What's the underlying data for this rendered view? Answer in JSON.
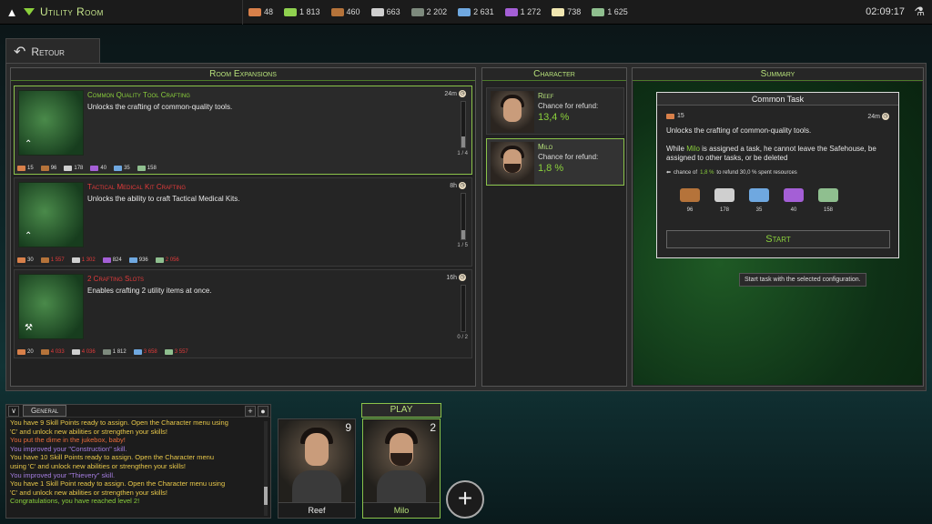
{
  "topbar": {
    "title": "Utility Room",
    "clock": "02:09:17",
    "resources": [
      {
        "icon": "strength-icon",
        "value": "48",
        "color": "#d8804a"
      },
      {
        "icon": "cash-icon",
        "value": "1 813",
        "color": "#8fd14f"
      },
      {
        "icon": "wood-icon",
        "value": "460",
        "color": "#b5733a"
      },
      {
        "icon": "stone-icon",
        "value": "663",
        "color": "#cfcfcf"
      },
      {
        "icon": "metal-plate-icon",
        "value": "2 202",
        "color": "#7d8a7d"
      },
      {
        "icon": "pipe-icon",
        "value": "2 631",
        "color": "#6fa8e0"
      },
      {
        "icon": "fabric-icon",
        "value": "1 272",
        "color": "#a45fd6"
      },
      {
        "icon": "chemical-flask-icon",
        "value": "738",
        "color": "#f0e6b0"
      },
      {
        "icon": "banknotes-icon",
        "value": "1 625",
        "color": "#8fbf8f"
      }
    ]
  },
  "back_label": "Retour",
  "room_expansions": {
    "header": "Room Expansions",
    "items": [
      {
        "title": "Common Quality Tool Crafting",
        "title_color": "#8bd13c",
        "desc": "Unlocks the crafting of common-quality tools.",
        "time": "24m",
        "progress": "1 / 4",
        "fraction": 0.25,
        "costs": [
          {
            "v": "15",
            "c": "#d8804a",
            "red": false
          },
          {
            "v": "96",
            "c": "#b5733a",
            "red": false
          },
          {
            "v": "178",
            "c": "#cfcfcf",
            "red": false
          },
          {
            "v": "40",
            "c": "#a45fd6",
            "red": false
          },
          {
            "v": "35",
            "c": "#6fa8e0",
            "red": false
          },
          {
            "v": "158",
            "c": "#8fbf8f",
            "red": false
          }
        ]
      },
      {
        "title": "Tactical Medical Kit Crafting",
        "title_color": "#e23b3b",
        "desc": "Unlocks the ability to craft Tactical Medical Kits.",
        "time": "8h",
        "progress": "1 / 5",
        "fraction": 0.2,
        "costs": [
          {
            "v": "30",
            "c": "#d8804a",
            "red": false
          },
          {
            "v": "1 557",
            "c": "#b5733a",
            "red": true
          },
          {
            "v": "1 302",
            "c": "#cfcfcf",
            "red": true
          },
          {
            "v": "824",
            "c": "#a45fd6",
            "red": false
          },
          {
            "v": "936",
            "c": "#6fa8e0",
            "red": false
          },
          {
            "v": "2 056",
            "c": "#8fbf8f",
            "red": true
          }
        ]
      },
      {
        "title": "2 Crafting Slots",
        "title_color": "#e23b3b",
        "desc": "Enables crafting 2 utility items at once.",
        "time": "16h",
        "progress": "0 / 2",
        "fraction": 0.0,
        "costs": [
          {
            "v": "20",
            "c": "#d8804a",
            "red": false
          },
          {
            "v": "4 033",
            "c": "#b5733a",
            "red": true
          },
          {
            "v": "4 036",
            "c": "#cfcfcf",
            "red": true
          },
          {
            "v": "1 812",
            "c": "#7d8a7d",
            "red": false
          },
          {
            "v": "3 658",
            "c": "#6fa8e0",
            "red": true
          },
          {
            "v": "3 557",
            "c": "#8fbf8f",
            "red": true
          }
        ]
      }
    ]
  },
  "character": {
    "header": "Character",
    "refund_label": "Chance for refund:",
    "cards": [
      {
        "name": "Reef",
        "value": "13,4 %"
      },
      {
        "name": "Milo",
        "value": "1,8 %"
      }
    ]
  },
  "summary": {
    "header": "Summary",
    "task_title": "Common Task",
    "strength": "15",
    "time": "24m",
    "desc": "Unlocks the crafting of common-quality tools.",
    "note_pre": "While ",
    "note_name": "Milo",
    "note_post": " is assigned a task, he cannot leave the Safehouse, be assigned to other tasks, or be deleted",
    "refund_pre": "chance of ",
    "refund_pct": "1,8 %",
    "refund_post": " to refund 30,0 % spent resources",
    "resources": [
      {
        "icon": "wood-icon",
        "value": "96",
        "color": "#b5733a"
      },
      {
        "icon": "stone-icon",
        "value": "178",
        "color": "#cfcfcf"
      },
      {
        "icon": "pipe-icon",
        "value": "35",
        "color": "#6fa8e0"
      },
      {
        "icon": "fabric-icon",
        "value": "40",
        "color": "#a45fd6"
      },
      {
        "icon": "banknotes-icon",
        "value": "158",
        "color": "#8fbf8f"
      }
    ],
    "start_label": "Start",
    "tooltip": "Start task with the selected configuration."
  },
  "chat": {
    "tab": "General",
    "lines": [
      {
        "text": "You have 9 Skill Points ready to assign. Open the Character menu using",
        "color": "#e8c84a"
      },
      {
        "text": "'C' and unlock new abilities or strengthen your skills!",
        "color": "#e8c84a"
      },
      {
        "text": "You put the dime in the jukebox, baby!",
        "color": "#e86a3a"
      },
      {
        "text": "You improved your \"Construction\" skill.",
        "color": "#a47de0"
      },
      {
        "text": "You have 10 Skill Points ready to assign. Open the Character menu",
        "color": "#e8c84a"
      },
      {
        "text": "using 'C' and unlock new abilities or strengthen your skills!",
        "color": "#e8c84a"
      },
      {
        "text": "You improved your \"Thievery\" skill.",
        "color": "#a47de0"
      },
      {
        "text": "You have 1 Skill Point ready to assign. Open the Character menu using",
        "color": "#e8c84a"
      },
      {
        "text": "'C' and unlock new abilities or strengthen your skills!",
        "color": "#e8c84a"
      },
      {
        "text": "Congratulations, you have reached level 2!",
        "color": "#8bd13c"
      }
    ]
  },
  "party": {
    "play_label": "PLAY",
    "members": [
      {
        "name": "Reef",
        "level": "9"
      },
      {
        "name": "Milo",
        "level": "2"
      }
    ]
  }
}
